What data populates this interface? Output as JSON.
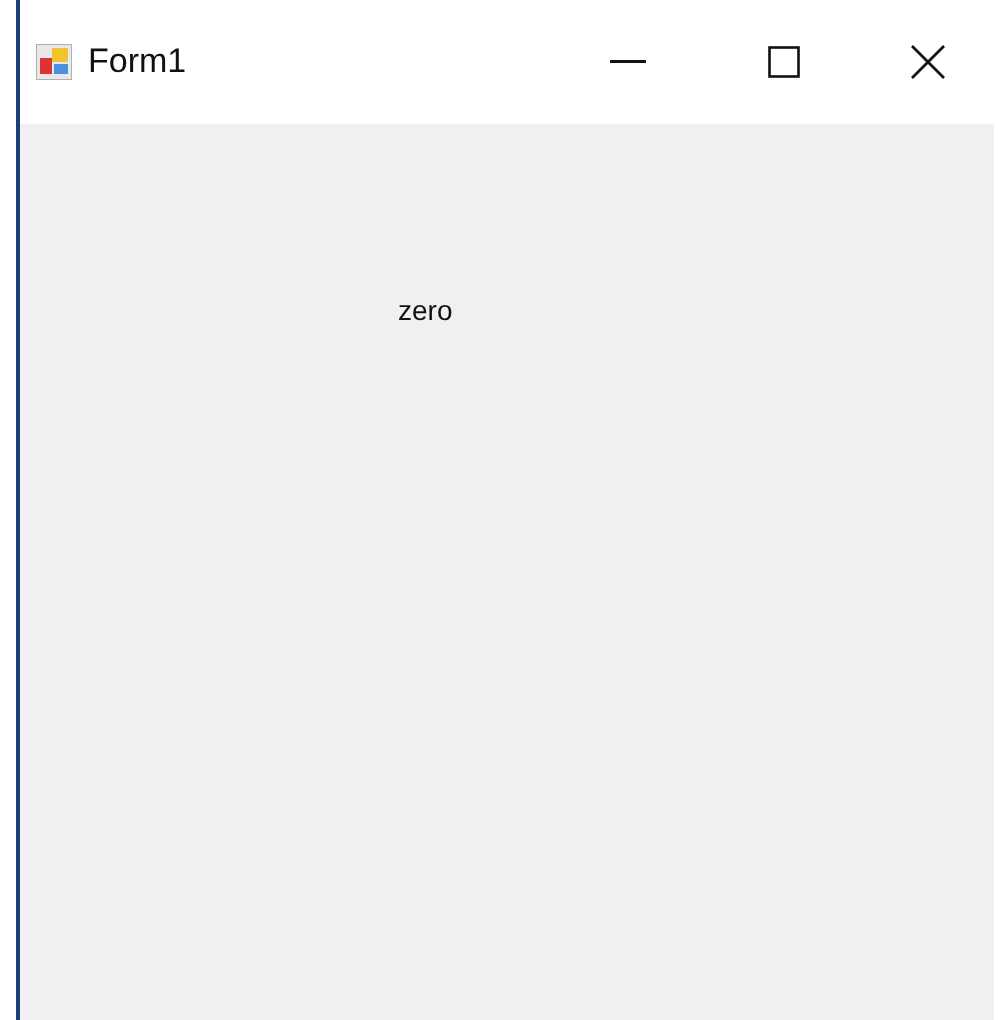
{
  "window": {
    "title": "Form1"
  },
  "form": {
    "label": "zero"
  }
}
